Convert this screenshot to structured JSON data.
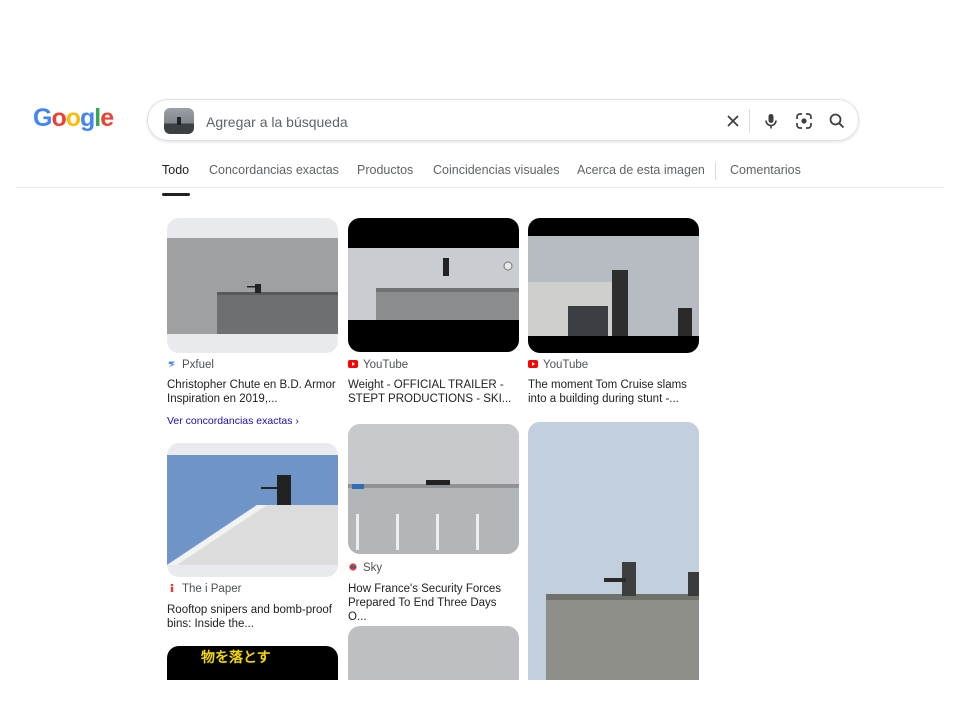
{
  "logo": {
    "text": "Google",
    "letters": [
      "G",
      "o",
      "o",
      "g",
      "l",
      "e"
    ],
    "colors": [
      "#4285f4",
      "#ea4335",
      "#fbbc05",
      "#4285f4",
      "#34a853",
      "#ea4335"
    ]
  },
  "search": {
    "placeholder": "Agregar a la búsqueda",
    "value": ""
  },
  "tabs": [
    {
      "label": "Todo",
      "active": true
    },
    {
      "label": "Concordancias exactas"
    },
    {
      "label": "Productos"
    },
    {
      "label": "Coincidencias visuales"
    },
    {
      "label": "Acerca de esta imagen"
    },
    {
      "label": "Comentarios"
    }
  ],
  "results": [
    {
      "source": "Pxfuel",
      "source_color": "#4285f4",
      "title": "Christopher Chute en B.D. Armor Inspiration en 2019,...",
      "link": "Ver concordancias exactas ›"
    },
    {
      "source": "YouTube",
      "source_color": "#ff0000",
      "title": "Weight - OFFICIAL TRAILER - STEPT PRODUCTIONS - SKI..."
    },
    {
      "source": "YouTube",
      "source_color": "#ff0000",
      "title": "The moment Tom Cruise slams into a building during stunt -..."
    },
    {
      "source": "The i Paper",
      "source_color": "#e53935",
      "title": "Rooftop snipers and bomb-proof bins: Inside the..."
    },
    {
      "source": "Sky",
      "source_color": "#e53935",
      "title": "How France's Security Forces Prepared To End Three Days O..."
    }
  ],
  "partial_thumb_caption": "物を落とす"
}
